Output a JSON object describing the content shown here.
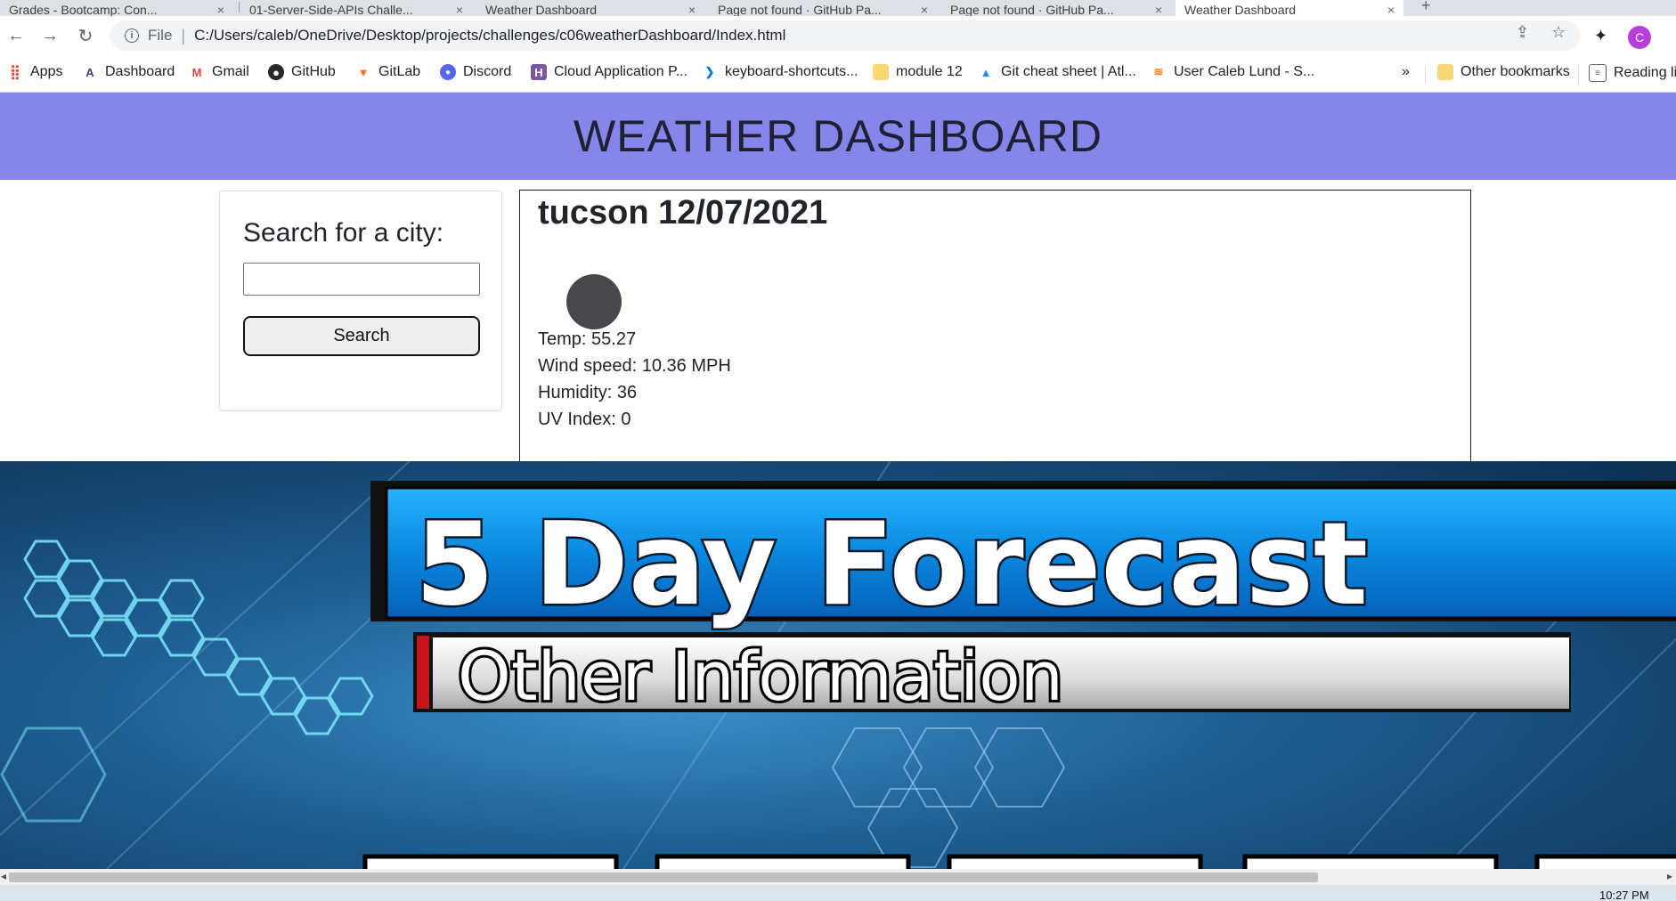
{
  "browser": {
    "tabs": [
      {
        "title": "Grades - Bootcamp: Con..."
      },
      {
        "title": "01-Server-Side-APIs Challe..."
      },
      {
        "title": "Weather Dashboard"
      },
      {
        "title": "Page not found · GitHub Pa..."
      },
      {
        "title": "Page not found · GitHub Pa..."
      },
      {
        "title": "Weather Dashboard"
      }
    ],
    "address": {
      "scheme_label": "File",
      "url": "C:/Users/caleb/OneDrive/Desktop/projects/challenges/c06weatherDashboard/Index.html"
    },
    "profile_initial": "C",
    "bookmarks": [
      {
        "label": "Apps",
        "icon": "apps-grid-icon"
      },
      {
        "label": "Dashboard",
        "icon": "dashboard-icon"
      },
      {
        "label": "Gmail",
        "icon": "gmail-icon"
      },
      {
        "label": "GitHub",
        "icon": "github-icon"
      },
      {
        "label": "GitLab",
        "icon": "gitlab-icon"
      },
      {
        "label": "Discord",
        "icon": "discord-icon"
      },
      {
        "label": "Cloud Application P...",
        "icon": "heroku-icon"
      },
      {
        "label": "keyboard-shortcuts...",
        "icon": "vscode-icon"
      },
      {
        "label": "module 12",
        "icon": "folder-icon"
      },
      {
        "label": "Git cheat sheet | Atl...",
        "icon": "atlassian-icon"
      },
      {
        "label": "User Caleb Lund - S...",
        "icon": "stackoverflow-icon"
      }
    ],
    "bookmarks_overflow": "»",
    "other_bookmarks": "Other bookmarks",
    "reading_list": "Reading list"
  },
  "page": {
    "header_title": "WEATHER DASHBOARD",
    "search": {
      "label": "Search for a city:",
      "input_value": "",
      "button_label": "Search"
    },
    "current": {
      "title": "tucson 12/07/2021",
      "temp": "Temp: 55.27",
      "wind": "Wind speed: 10.36 MPH",
      "humidity": "Humidity: 36",
      "uv": "UV Index: 0"
    },
    "banner": {
      "headline": "5 Day Forecast",
      "subline": "Other Information"
    }
  },
  "taskbar": {
    "clock": "10:27 PM"
  },
  "colors": {
    "header_bg": "#8585ea",
    "banner_blue": "#0a88e0",
    "avatar": "#b83fd9"
  }
}
